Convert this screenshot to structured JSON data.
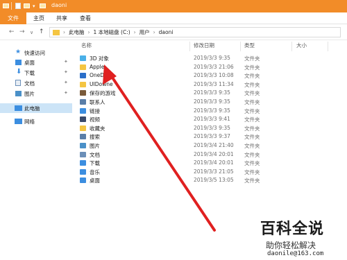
{
  "window": {
    "title": "daoni"
  },
  "ribbon": {
    "tabs": [
      "文件",
      "主页",
      "共享",
      "查看"
    ]
  },
  "address": {
    "path": [
      "此电脑",
      "1 本地磁盘 (C:)",
      "用户",
      "daoni"
    ]
  },
  "sidebar": {
    "items": [
      {
        "label": "快速访问",
        "icon": "star-icon",
        "color": "#3c8ee0",
        "pinned": false
      },
      {
        "label": "桌面",
        "icon": "desktop-icon",
        "color": "#3c8ee0",
        "pinned": true
      },
      {
        "label": "下载",
        "icon": "download-icon",
        "color": "#3c8ee0",
        "pinned": true
      },
      {
        "label": "文档",
        "icon": "document-icon",
        "color": "#6b8fb8",
        "pinned": true
      },
      {
        "label": "图片",
        "icon": "pictures-icon",
        "color": "#4a90c8",
        "pinned": true
      },
      {
        "label": "此电脑",
        "icon": "computer-icon",
        "color": "#3c8ee0",
        "pinned": false,
        "selected": true
      },
      {
        "label": "网络",
        "icon": "network-icon",
        "color": "#3c8ee0",
        "pinned": false
      }
    ]
  },
  "columns": {
    "name": "名称",
    "date": "修改日期",
    "type": "类型",
    "size": "大小"
  },
  "files": [
    {
      "name": "3D 对象",
      "date": "2019/3/3 9:35",
      "type": "文件夹",
      "icon": "3d-objects-icon",
      "color": "#4ab0e8"
    },
    {
      "name": "Apple",
      "date": "2019/3/3 21:06",
      "type": "文件夹",
      "icon": "folder-icon",
      "color": "#f4c542"
    },
    {
      "name": "OneDri",
      "date": "2019/3/3 10:08",
      "type": "文件夹",
      "icon": "onedrive-icon",
      "color": "#2b6fc9"
    },
    {
      "name": "UIDowne",
      "date": "2019/3/3 11:34",
      "type": "文件夹",
      "icon": "folder-icon",
      "color": "#f4c542"
    },
    {
      "name": "保存的游戏",
      "date": "2019/3/3 9:35",
      "type": "文件夹",
      "icon": "saved-games-icon",
      "color": "#7a5a3a"
    },
    {
      "name": "联系人",
      "date": "2019/3/3 9:35",
      "type": "文件夹",
      "icon": "contacts-icon",
      "color": "#5a7ea8"
    },
    {
      "name": "链接",
      "date": "2019/3/3 9:35",
      "type": "文件夹",
      "icon": "links-icon",
      "color": "#3c8ee0"
    },
    {
      "name": "视频",
      "date": "2019/3/3 9:41",
      "type": "文件夹",
      "icon": "videos-icon",
      "color": "#3a4a6a"
    },
    {
      "name": "收藏夹",
      "date": "2019/3/3 9:35",
      "type": "文件夹",
      "icon": "favorites-icon",
      "color": "#f4c542"
    },
    {
      "name": "搜索",
      "date": "2019/3/3 9:37",
      "type": "文件夹",
      "icon": "search-icon",
      "color": "#5a7ea8"
    },
    {
      "name": "图片",
      "date": "2019/3/4 21:40",
      "type": "文件夹",
      "icon": "pictures-icon",
      "color": "#4a90c8"
    },
    {
      "name": "文档",
      "date": "2019/3/4 20:01",
      "type": "文件夹",
      "icon": "document-icon",
      "color": "#6b8fb8"
    },
    {
      "name": "下载",
      "date": "2019/3/4 20:01",
      "type": "文件夹",
      "icon": "download-icon",
      "color": "#3c8ee0"
    },
    {
      "name": "音乐",
      "date": "2019/3/3 21:05",
      "type": "文件夹",
      "icon": "music-icon",
      "color": "#3c8ee0"
    },
    {
      "name": "桌面",
      "date": "2019/3/5 13:05",
      "type": "文件夹",
      "icon": "desktop-icon",
      "color": "#3c8ee0"
    }
  ],
  "watermark": {
    "brand": "百科全说",
    "slogan": "助你轻松解决",
    "email": "daonile@163.com"
  }
}
